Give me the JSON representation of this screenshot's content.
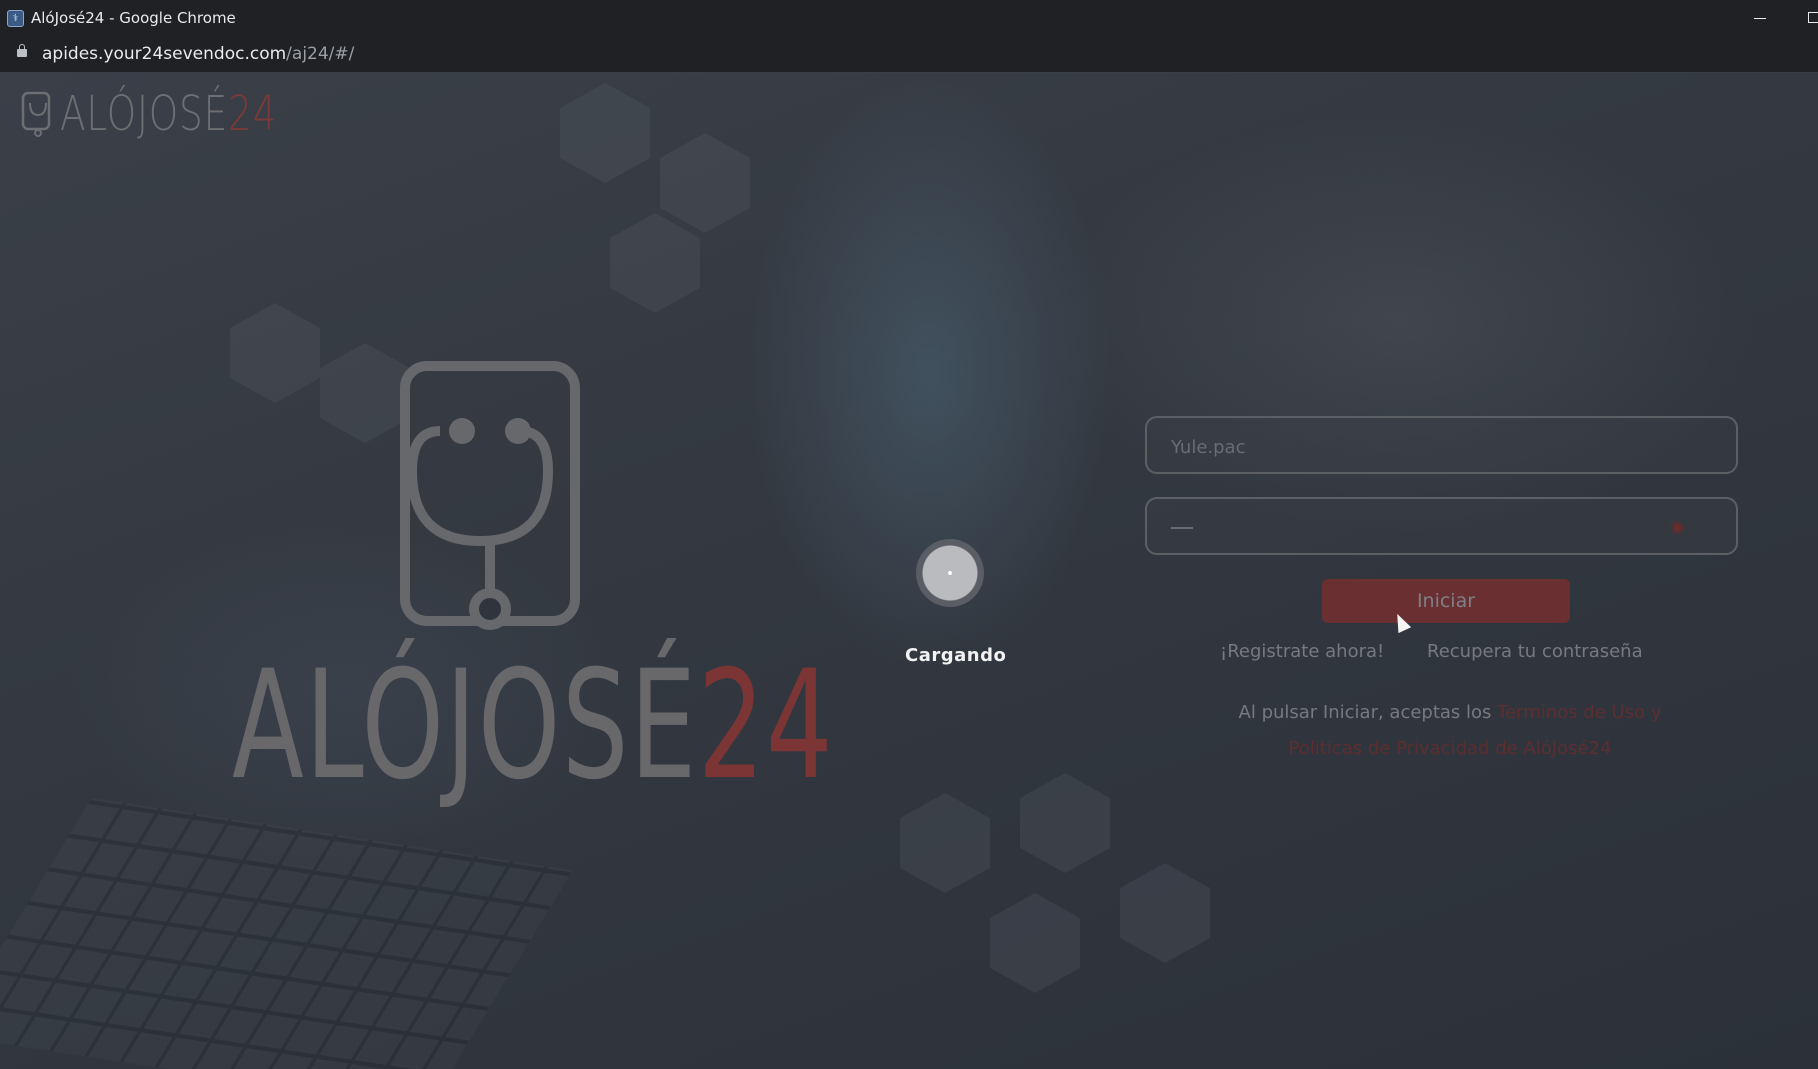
{
  "window": {
    "title": "AlóJosé24 - Google Chrome"
  },
  "address_bar": {
    "url_host": "apides.your24sevendoc.com",
    "url_path": "/aj24/#/"
  },
  "brand": {
    "name_main": "ALÓJOSÉ",
    "name_num": "24"
  },
  "loader": {
    "text": "Cargando"
  },
  "login": {
    "username_value": "Yule.pac",
    "submit_label": "Iniciar",
    "register_link": "¡Registrate ahora!",
    "recover_link": "Recupera tu contraseña",
    "terms_prefix": "Al pulsar Iniciar, aceptas los ",
    "terms_link_1": "Terminos de Uso y",
    "terms_link_2": "Politicas de Privacidad de AlóJosé24"
  },
  "colors": {
    "accent": "#7c3535",
    "overlay": "#2f343d"
  }
}
